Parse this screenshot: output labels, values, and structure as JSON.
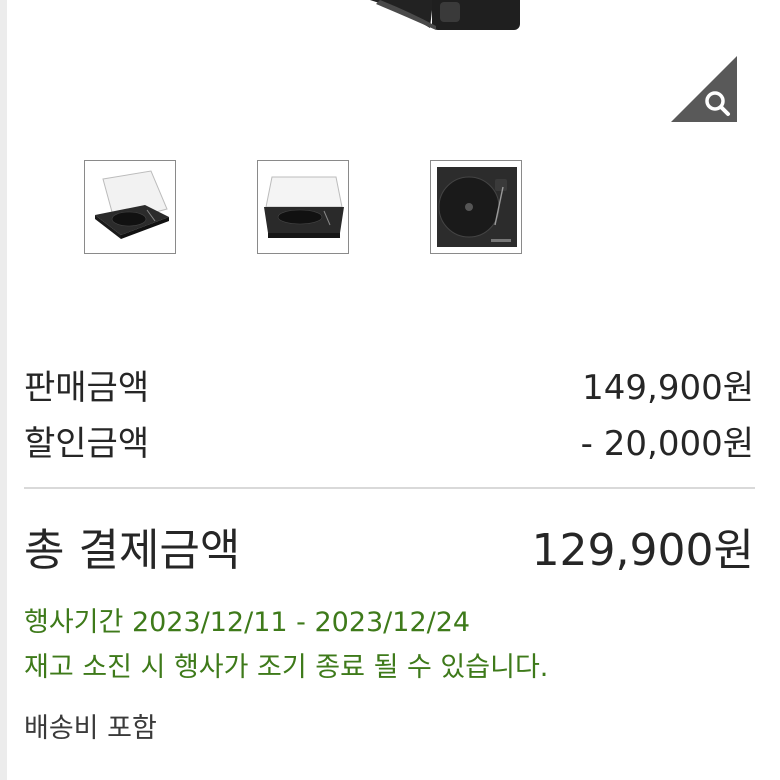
{
  "pricing": {
    "sale_label": "판매금액",
    "sale_value": "149,900원",
    "discount_label": "할인금액",
    "discount_value": "- 20,000원",
    "total_label": "총 결제금액",
    "total_value": "129,900원"
  },
  "promo": {
    "period": "행사기간 2023/12/11 - 2023/12/24",
    "notice": "재고 소진 시 행사가 조기 종료 될 수 있습니다."
  },
  "shipping": {
    "note": "배송비 포함"
  },
  "icons": {
    "zoom": "magnifier-icon"
  },
  "colors": {
    "promo_green": "#3e7a1a",
    "zoom_badge": "#595959",
    "divider": "#d9d9d9"
  }
}
